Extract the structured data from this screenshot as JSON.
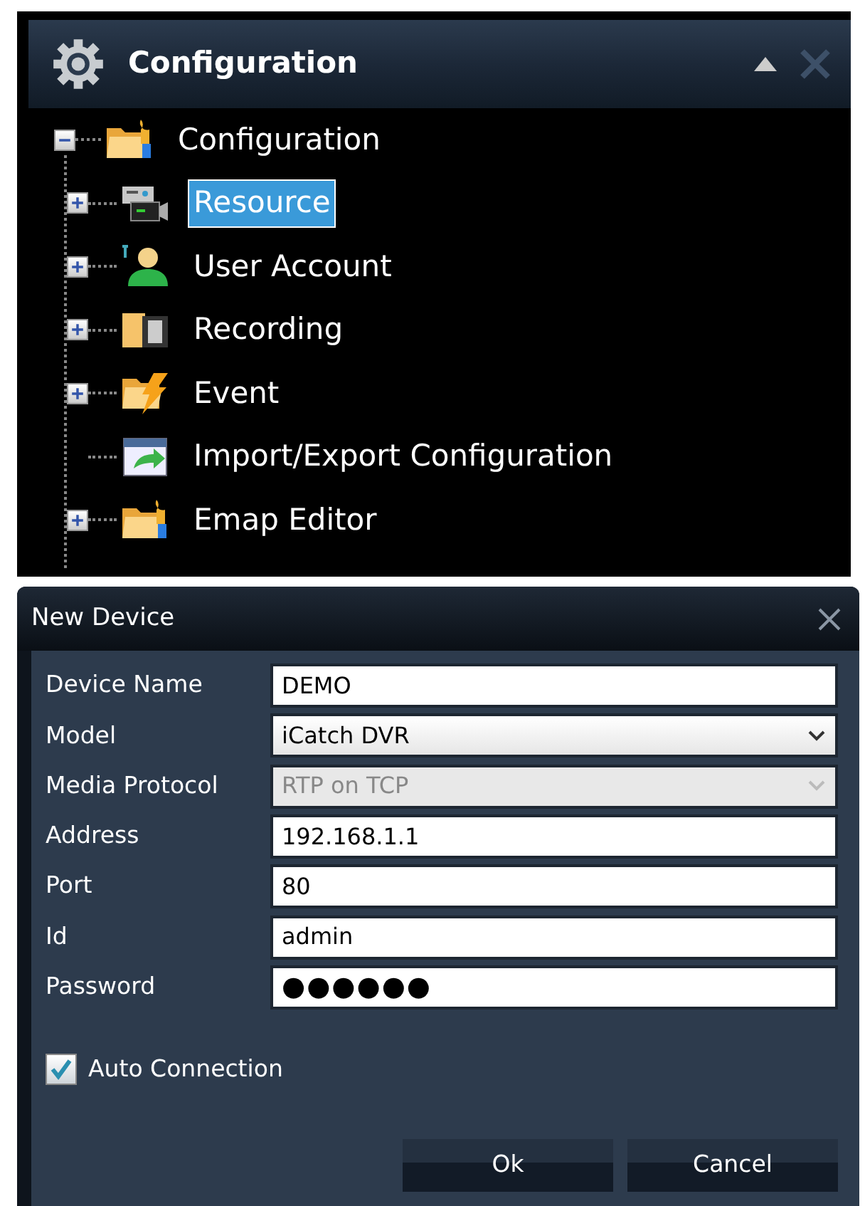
{
  "config_panel": {
    "title": "Configuration",
    "tree": [
      {
        "label": "Configuration",
        "expanded": true,
        "selected": false,
        "children": [
          {
            "label": "Resource",
            "expandable": true,
            "selected": true
          },
          {
            "label": "User Account",
            "expandable": true,
            "selected": false
          },
          {
            "label": "Recording",
            "expandable": true,
            "selected": false
          },
          {
            "label": "Event",
            "expandable": true,
            "selected": false
          },
          {
            "label": "Import/Export Configuration",
            "expandable": false,
            "selected": false
          },
          {
            "label": "Emap Editor",
            "expandable": true,
            "selected": false
          }
        ]
      }
    ]
  },
  "new_device_dialog": {
    "title": "New Device",
    "fields": [
      {
        "label": "Device Name",
        "kind": "text",
        "value": "DEMO",
        "disabled": false
      },
      {
        "label": "Model",
        "kind": "select",
        "value": "iCatch DVR",
        "disabled": false
      },
      {
        "label": "Media Protocol",
        "kind": "select",
        "value": "RTP on TCP",
        "disabled": true
      },
      {
        "label": "Address",
        "kind": "text",
        "value": "192.168.1.1",
        "disabled": false
      },
      {
        "label": "Port",
        "kind": "text",
        "value": "80",
        "disabled": false
      },
      {
        "label": "Id",
        "kind": "text",
        "value": "admin",
        "disabled": false
      },
      {
        "label": "Password",
        "kind": "password",
        "value": "●●●●●●",
        "disabled": false
      }
    ],
    "auto_connection": {
      "label": "Auto Connection",
      "checked": true
    },
    "buttons": [
      "Ok",
      "Cancel"
    ]
  }
}
